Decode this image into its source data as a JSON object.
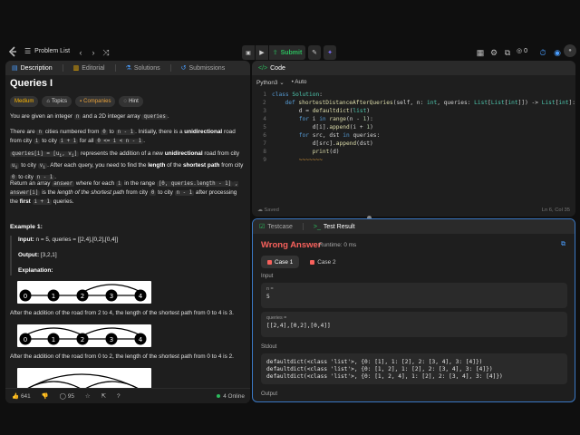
{
  "topbar": {
    "problem_list": "Problem List",
    "submit": "Submit",
    "coins": "0"
  },
  "left_tabs": {
    "description": "Description",
    "editorial": "Editorial",
    "solutions": "Solutions",
    "submissions": "Submissions"
  },
  "problem": {
    "title": "Queries I",
    "chips": {
      "difficulty": "Medium",
      "topics": "Topics",
      "companies": "Companies",
      "hint": "Hint"
    },
    "p1": [
      "You are given an integer ",
      "n",
      " and a 2D integer array ",
      "queries",
      "."
    ],
    "p2a": [
      "There are ",
      "n",
      " cities numbered from ",
      "0",
      " to ",
      "n - 1",
      ". Initially, there is a "
    ],
    "p2b": "unidirectional",
    "p2c": [
      " road from city ",
      "i",
      " to city ",
      "i + 1",
      " for all ",
      "0 <= i < n - 1",
      "."
    ],
    "p3a": [
      "queries[i] = [u",
      "i",
      ", v",
      "i",
      "]"
    ],
    "p3": "represents the addition of a new",
    "p3b": "unidirectional",
    "p3c": "road from city",
    "p3d": "to city",
    "p3e": ". After each query, you need to find the",
    "p3f": "length",
    "p3g": "of the",
    "p3h": "shortest path",
    "p3i": "from city",
    "p3j": "to city",
    "p4a": "Return an array",
    "p4b": "answer",
    "p4c": "where for each",
    "p4d": "in the range",
    "p4e": "[0, queries.length - 1]",
    "p4f": ", answer[i]",
    "p4g": "is the",
    "p4h": "length of the shortest path",
    "p4i": "from city",
    "p4j": "to city",
    "p4k": "after processing the",
    "p4l": "first",
    "p4m": "queries.",
    "ex_title": "Example 1:",
    "input_label": "Input:",
    "input_value": "n = 5, queries = [[2,4],[0,2],[0,4]]",
    "output_label": "Output:",
    "output_value": "[3,2,1]",
    "explanation_label": "Explanation:",
    "expl1": "After the addition of the road from 2 to 4, the length of the shortest path from 0 to 4 is 3.",
    "expl2": "After the addition of the road from 0 to 2, the length of the shortest path from 0 to 4 is 2."
  },
  "left_footer": {
    "likes": "641",
    "comments": "95",
    "online": "4 Online"
  },
  "code_tabs": {
    "code": "Code"
  },
  "code": {
    "language": "Python3",
    "auto": "Auto",
    "status_left": "Saved",
    "status_right": "Ln 6, Col 35"
  },
  "result_tabs": {
    "testcase": "Testcase",
    "test_result": "Test Result"
  },
  "result": {
    "verdict": "Wrong Answer",
    "runtime": "Runtime: 0 ms",
    "case1": "Case 1",
    "case2": "Case 2",
    "input_label": "Input",
    "n_label": "n =",
    "n_value": "5",
    "queries_label": "queries =",
    "queries_value": "[[2,4],[0,2],[0,4]]",
    "stdout_label": "Stdout",
    "stdout": "defaultdict(<class 'list'>, {0: [1], 1: [2], 2: [3, 4], 3: [4]})\ndefaultdict(<class 'list'>, {0: [1, 2], 1: [2], 2: [3, 4], 3: [4]})\ndefaultdict(<class 'list'>, {0: [1, 2, 4], 1: [2], 2: [3, 4], 3: [4]})",
    "output_label": "Output"
  },
  "colors": {
    "wrong": "#f8615c",
    "medium": "#ffb800",
    "accent": "#3a78c4",
    "submit": "#2cbb5d"
  }
}
